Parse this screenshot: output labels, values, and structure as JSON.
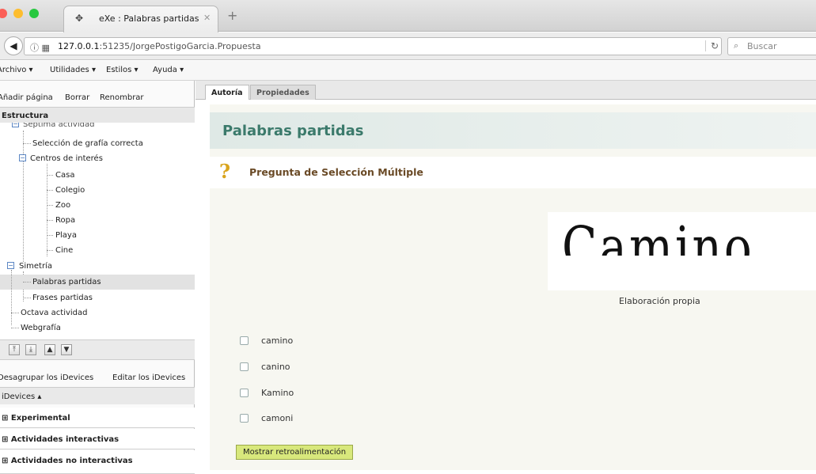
{
  "browser": {
    "tab_title": "eXe : Palabras partidas",
    "url_host": "127.0.0.1",
    "url_rest": ":51235/JorgePostigoGarcia.Propuesta",
    "search_placeholder": "Buscar",
    "icons": {
      "back": "back-arrow-icon",
      "info": "info-icon",
      "reload": "reload-icon",
      "search": "search-icon",
      "close": "close-icon",
      "new_tab": "plus-icon"
    }
  },
  "menu": [
    "Archivo ▾",
    "Utilidades ▾",
    "Estilos ▾",
    "Ayuda ▾"
  ],
  "page_actions": [
    "Añadir página",
    "Borrar",
    "Renombrar"
  ],
  "structure_title": "Estructura",
  "tree": {
    "partial_top": "Séptima actividad",
    "items": [
      {
        "label": "Selección de grafía correcta"
      },
      {
        "label": "Centros de interés"
      },
      {
        "label": "Casa"
      },
      {
        "label": "Colegio"
      },
      {
        "label": "Zoo"
      },
      {
        "label": "Ropa"
      },
      {
        "label": "Playa"
      },
      {
        "label": "Cine"
      },
      {
        "label": "Simetría"
      },
      {
        "label": "Palabras partidas"
      },
      {
        "label": "Frases partidas"
      },
      {
        "label": "Octava actividad"
      },
      {
        "label": "Webgrafía"
      }
    ],
    "selected": "Palabras partidas"
  },
  "move_buttons": [
    "move-top-icon",
    "move-bottom-icon",
    "move-up-icon",
    "move-down-icon"
  ],
  "idevice_actions": [
    "Desagrupar los iDevices",
    "Editar los iDevices"
  ],
  "idevices_header": "iDevices ▴",
  "idevice_categories": [
    "Experimental",
    "Actividades interactivas",
    "Actividades no interactivas"
  ],
  "tabs": [
    "Autoría",
    "Propiedades"
  ],
  "page_title": "Palabras partidas",
  "idevice_title": "Pregunta de Selección Múltiple",
  "image_word": "Camino",
  "image_caption": "Elaboración propia",
  "options": [
    "camino",
    "canino",
    "Kamino",
    "camoni"
  ],
  "feedback_button": "Mostrar retroalimentación",
  "colors": {
    "page_title": "#3b7a6b",
    "idevice_title": "#6a4a26",
    "feedback_button": "#d8e87c"
  }
}
